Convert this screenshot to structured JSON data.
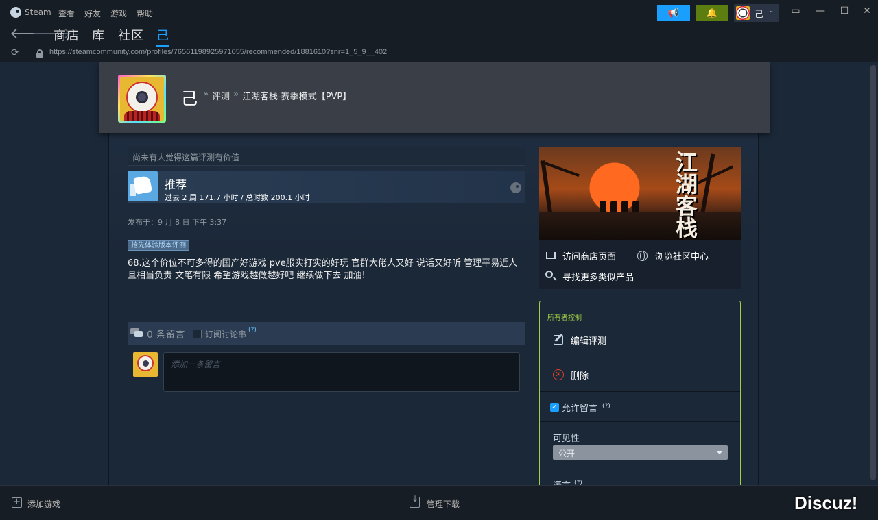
{
  "menubar": {
    "app_name": "Steam",
    "items": [
      "查看",
      "好友",
      "游戏",
      "帮助"
    ],
    "username": "己",
    "broadcast_icon": "megaphone-icon",
    "notify_icon": "bell-icon",
    "colors": {
      "broadcast": "#1a9fff",
      "notify": "#5c7e10"
    }
  },
  "nav": {
    "links": [
      "商店",
      "库",
      "社区",
      "己"
    ],
    "active": "己"
  },
  "urlbar": {
    "url": "https://steamcommunity.com/profiles/76561198925971055/recommended/1881610?snr=1_5_9__402"
  },
  "header": {
    "user": "己",
    "sep": "»",
    "section": "评测",
    "game": "江湖客栈-赛季模式【PVP】"
  },
  "review": {
    "helpful_text": "尚未有人觉得这篇评测有价值",
    "verdict": "推荐",
    "hours": "过去 2 周 171.7 小时 / 总时数 200.1 小时",
    "posted": "发布于：9 月 8 日 下午 3:37",
    "badge": "抢先体验版本评测",
    "text": "68.这个价位不可多得的国产好游戏 pve服实打实的好玩 官群大佬人又好 说话又好听 管理平易近人且相当负责 文笔有限 希望游戏越做越好吧 继续做下去 加油!"
  },
  "comments": {
    "count": "0 条留言",
    "subscribe": "订阅讨论串",
    "help": "(?)",
    "placeholder": "添加一条留言"
  },
  "game_card": {
    "art_title": "江湖客栈",
    "store_link": "访问商店页面",
    "community_link": "浏览社区中心",
    "similar_link": "寻找更多类似产品"
  },
  "owner": {
    "title": "所有者控制",
    "edit": "编辑评测",
    "delete": "删除",
    "allow_comments": "允许留言",
    "help": "(?)",
    "visibility_label": "可见性",
    "visibility_value": "公开",
    "language_label": "语言",
    "accent": "#a1cd44"
  },
  "bottombar": {
    "add_game": "添加游戏",
    "manage_downloads": "管理下载",
    "watermark": "Discuz!"
  }
}
